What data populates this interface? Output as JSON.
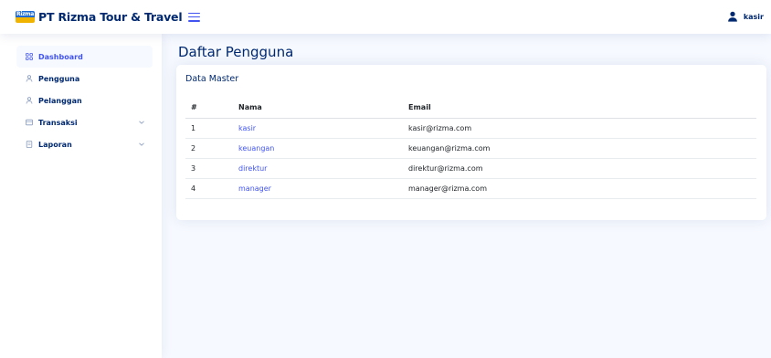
{
  "header": {
    "logo_text": "Rizma",
    "app_title": "PT Rizma Tour & Travel",
    "user_name": "kasir"
  },
  "sidebar": {
    "items": [
      {
        "label": "Dashboard",
        "icon": "grid-icon",
        "active": true
      },
      {
        "label": "Pengguna",
        "icon": "person-icon"
      },
      {
        "label": "Pelanggan",
        "icon": "person-icon"
      },
      {
        "label": "Transaksi",
        "icon": "receipt-icon",
        "expandable": true
      },
      {
        "label": "Laporan",
        "icon": "document-icon",
        "expandable": true
      }
    ]
  },
  "main": {
    "page_title": "Daftar Pengguna",
    "card_title": "Data Master",
    "table": {
      "headers": [
        "#",
        "Nama",
        "Email"
      ],
      "rows": [
        {
          "no": "1",
          "name": "kasir",
          "email": "kasir@rizma.com"
        },
        {
          "no": "2",
          "name": "keuangan",
          "email": "keuangan@rizma.com"
        },
        {
          "no": "3",
          "name": "direktur",
          "email": "direktur@rizma.com"
        },
        {
          "no": "4",
          "name": "manager",
          "email": "manager@rizma.com"
        }
      ]
    }
  },
  "colors": {
    "primary": "#4154f1",
    "navy": "#012970",
    "background": "#f6f9ff"
  }
}
